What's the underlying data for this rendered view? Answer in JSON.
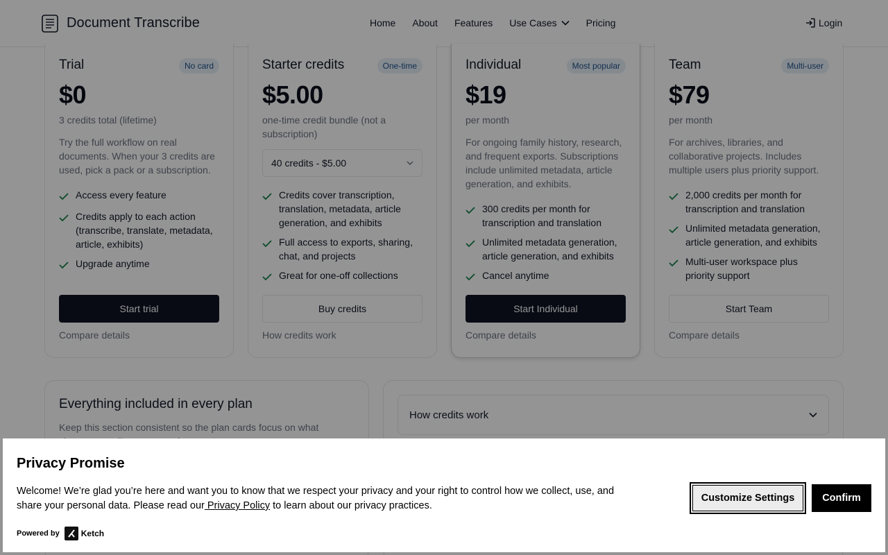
{
  "header": {
    "app_name": "Document Transcribe",
    "nav": [
      {
        "label": "Home"
      },
      {
        "label": "About"
      },
      {
        "label": "Features"
      },
      {
        "label": "Use Cases"
      },
      {
        "label": "Pricing"
      }
    ],
    "login": "Login"
  },
  "plans": [
    {
      "name": "Trial",
      "badge": "No card",
      "price": "$0",
      "sub": "3 credits total (lifetime)",
      "desc": "Try the full workflow on real documents. When your 3 credits are used, pick a pack or a subscription.",
      "features": [
        "Access every feature",
        "Credits apply to each action (transcribe, translate, metadata, article, exhibits)",
        "Upgrade anytime"
      ],
      "cta": "Start trial",
      "link": "Compare details"
    },
    {
      "name": "Starter credits",
      "badge": "One-time",
      "price": "$5.00",
      "sub": "one-time credit bundle (not a subscription)",
      "select_value": "40 credits - $5.00",
      "features": [
        "Credits cover transcription, translation, metadata, article generation, and exhibits",
        "Full access to exports, sharing, chat, and projects",
        "Great for one-off collections"
      ],
      "cta": "Buy credits",
      "link": "How credits work"
    },
    {
      "name": "Individual",
      "badge": "Most popular",
      "price": "$19",
      "sub": "per month",
      "desc": "For ongoing family history, research, and frequent exports. Subscriptions include unlimited metadata, article generation, and exhibits.",
      "features": [
        "300 credits per month for transcription and translation",
        "Unlimited metadata generation, article generation, and exhibits",
        "Cancel anytime"
      ],
      "cta": "Start Individual",
      "link": "Compare details"
    },
    {
      "name": "Team",
      "badge": "Multi-user",
      "price": "$79",
      "sub": "per month",
      "desc": "For archives, libraries, and collaborative projects. Includes multiple users plus priority support.",
      "features": [
        "2,000 credits per month for transcription and translation",
        "Unlimited metadata generation, article generation, and exhibits",
        "Multi-user workspace plus priority support"
      ],
      "cta": "Start Team",
      "link": "Compare details"
    }
  ],
  "everything": {
    "title": "Everything included in every plan",
    "desc": "Keep this section consistent so the plan cards focus on what changes: credits, seats, and support."
  },
  "accordion": {
    "label": "How credits work"
  },
  "cookie_banner": {
    "title": "Privacy Promise",
    "text_before": "Welcome! We’re glad you’re here and want you to know that we respect your privacy and your right to control how we collect, use, and share your personal data. Please read our",
    "link": " Privacy Policy",
    "text_after": " to learn about our privacy practices.",
    "powered_by": "Powered by",
    "brand": "Ketch",
    "customize": "Customize Settings",
    "confirm": "Confirm"
  },
  "colors": {
    "primary_button": "#0e1424",
    "badge_bg": "#e6eef7",
    "badge_text": "#1d4e89",
    "check": "#16804a"
  }
}
